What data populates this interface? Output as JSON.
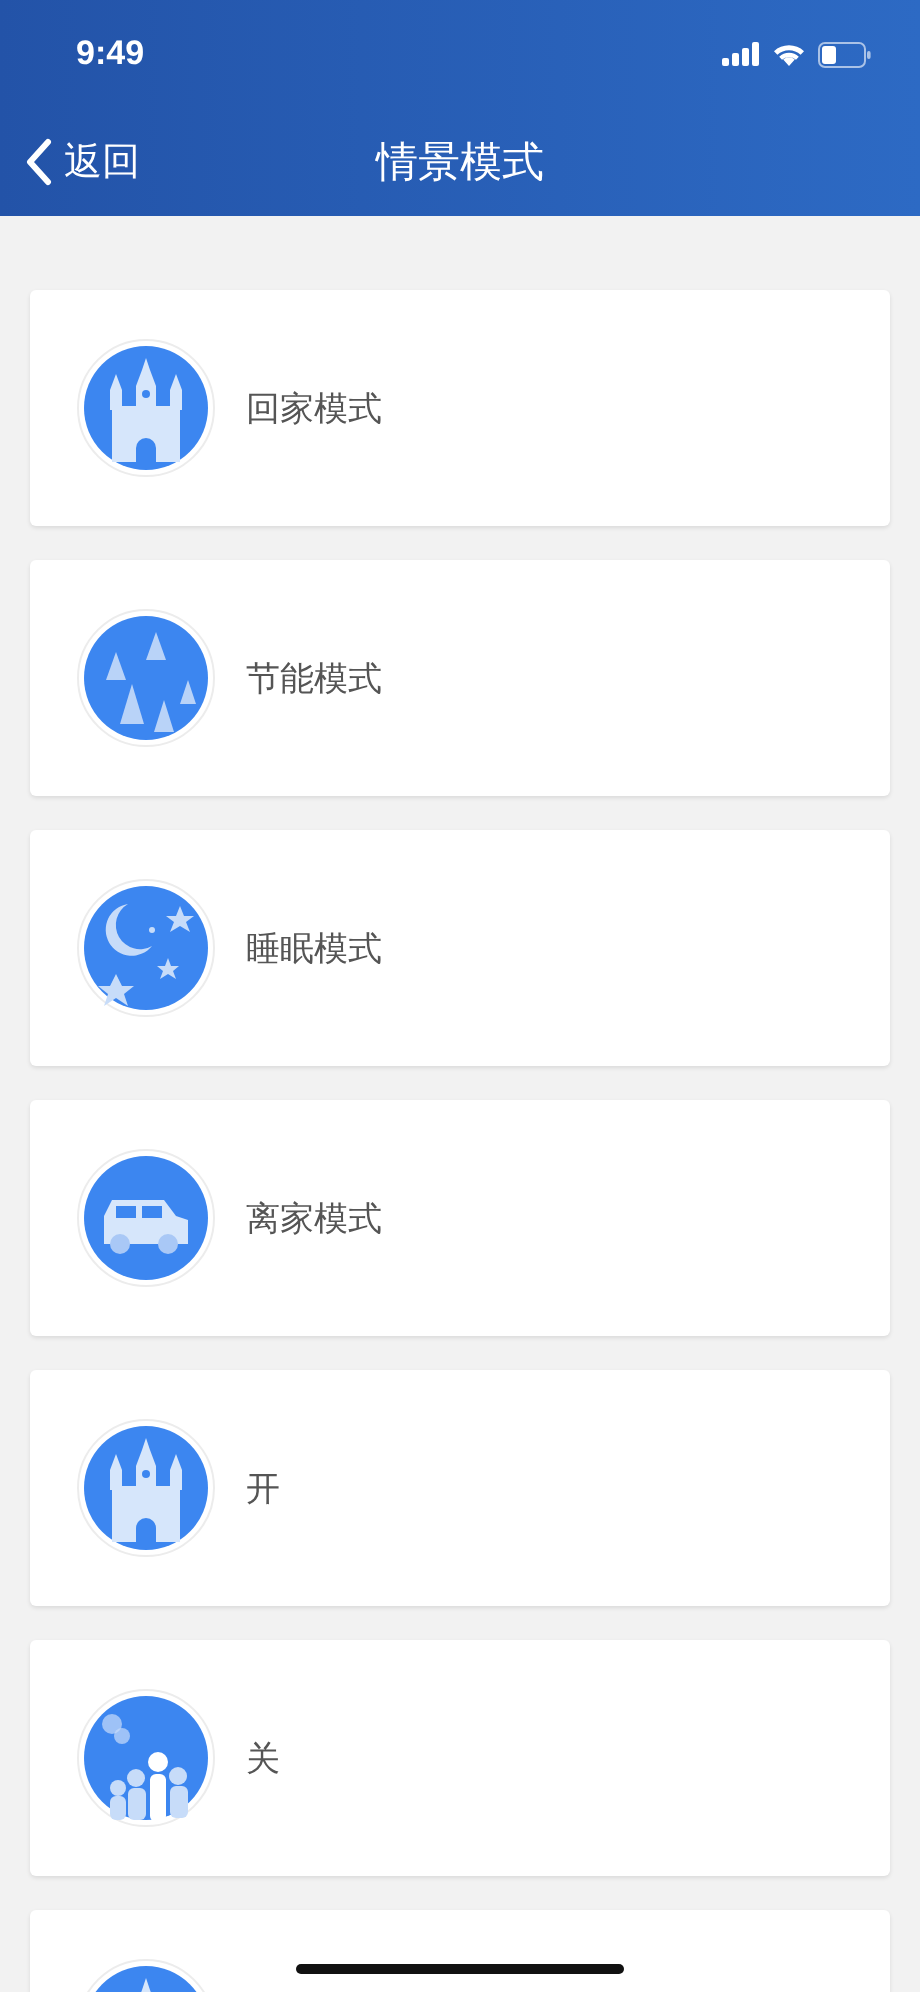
{
  "status_bar": {
    "time": "9:49"
  },
  "nav": {
    "back": "返回",
    "title": "情景模式"
  },
  "scenes": [
    {
      "kind": "castle",
      "label": "回家模式"
    },
    {
      "kind": "trees",
      "label": "节能模式"
    },
    {
      "kind": "moon",
      "label": "睡眠模式"
    },
    {
      "kind": "car",
      "label": "离家模式"
    },
    {
      "kind": "castle",
      "label": "开"
    },
    {
      "kind": "people",
      "label": "关"
    },
    {
      "kind": "castle"
    }
  ]
}
